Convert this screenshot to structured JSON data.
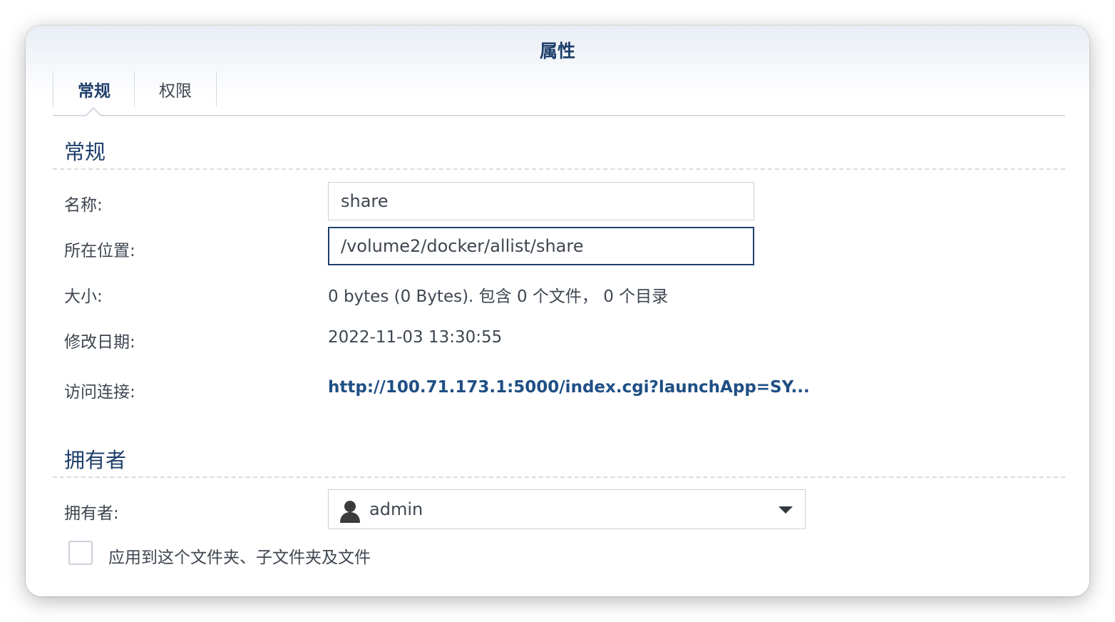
{
  "dialog": {
    "title": "属性"
  },
  "tabs": [
    {
      "label": "常规",
      "active": true
    },
    {
      "label": "权限",
      "active": false
    }
  ],
  "general_section": {
    "title": "常规",
    "name_label": "名称:",
    "name_value": "share",
    "location_label": "所在位置:",
    "location_value": "/volume2/docker/allist/share",
    "size_label": "大小:",
    "size_value": "0 bytes (0 Bytes). 包含 0 个文件， 0 个目录",
    "modified_label": "修改日期:",
    "modified_value": "2022-11-03 13:30:55",
    "access_label": "访问连接:",
    "access_value": "http://100.71.173.1:5000/index.cgi?launchApp=SY..."
  },
  "owner_section": {
    "title": "拥有者",
    "owner_label": "拥有者:",
    "owner_value": "admin",
    "owner_icon": "user-icon",
    "apply_checkbox_label": "应用到这个文件夹、子文件夹及文件",
    "apply_checked": false
  },
  "colors": {
    "accent": "#1f3f6b",
    "link": "#1f4f84",
    "text": "#3e4650",
    "border": "#c9d0d8"
  }
}
